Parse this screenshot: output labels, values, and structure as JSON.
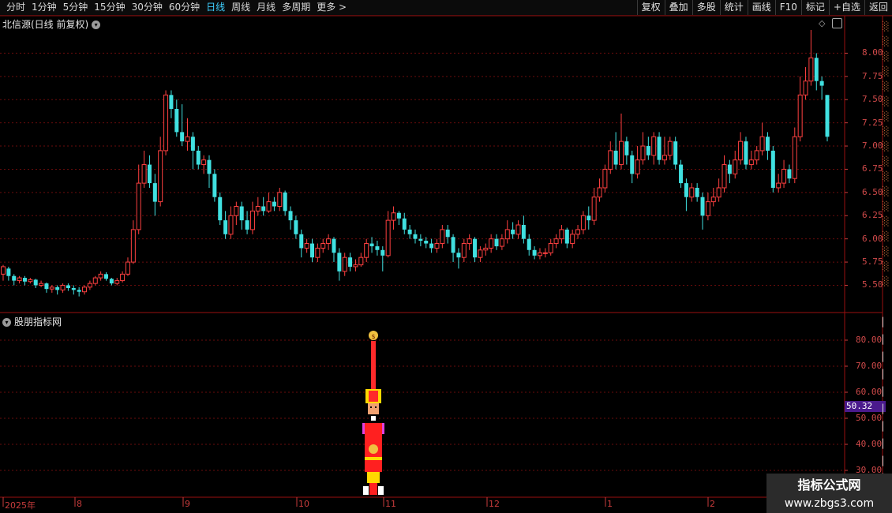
{
  "toolbar": {
    "periods": [
      "分时",
      "1分钟",
      "5分钟",
      "15分钟",
      "30分钟",
      "60分钟",
      "日线",
      "周线",
      "月线",
      "多周期",
      "更多 >"
    ],
    "active_period": "日线",
    "buttons": [
      "复权",
      "叠加",
      "多股",
      "统计",
      "画线",
      "F10",
      "标记",
      "+自选",
      "返回"
    ]
  },
  "main_pane": {
    "title": "北信源(日线 前复权)",
    "price_ticks": [
      "8.00",
      "7.75",
      "7.50",
      "7.25",
      "7.00",
      "6.75",
      "6.50",
      "6.25",
      "6.00",
      "5.75",
      "5.50"
    ]
  },
  "indicator_pane": {
    "title": "股朋指标网",
    "ticks": [
      "80.00",
      "70.00",
      "60.00",
      "50.00",
      "40.00",
      "30.00"
    ],
    "current_value": "50.32"
  },
  "dates": [
    "2025年",
    "8",
    "9",
    "10",
    "11",
    "12",
    "1",
    "2"
  ],
  "watermark": {
    "line1": "指标公式网",
    "line2": "www.zbgs3.com"
  },
  "colors": {
    "up": "#ff4040",
    "down": "#40e0e0",
    "grid": "#6a0c0c",
    "active": "#3fd0ff"
  },
  "chart_data": {
    "type": "candlestick",
    "ylim": [
      5.3,
      8.25
    ],
    "candles": [
      [
        5.62,
        5.7,
        5.72,
        5.55
      ],
      [
        5.68,
        5.6,
        5.7,
        5.55
      ],
      [
        5.6,
        5.55,
        5.62,
        5.5
      ],
      [
        5.55,
        5.58,
        5.6,
        5.52
      ],
      [
        5.58,
        5.54,
        5.6,
        5.5
      ],
      [
        5.54,
        5.56,
        5.58,
        5.52
      ],
      [
        5.56,
        5.5,
        5.57,
        5.47
      ],
      [
        5.5,
        5.52,
        5.55,
        5.48
      ],
      [
        5.52,
        5.46,
        5.53,
        5.42
      ],
      [
        5.46,
        5.48,
        5.5,
        5.42
      ],
      [
        5.48,
        5.45,
        5.5,
        5.4
      ],
      [
        5.45,
        5.5,
        5.52,
        5.42
      ],
      [
        5.5,
        5.47,
        5.52,
        5.44
      ],
      [
        5.47,
        5.45,
        5.5,
        5.4
      ],
      [
        5.45,
        5.43,
        5.48,
        5.38
      ],
      [
        5.43,
        5.48,
        5.5,
        5.4
      ],
      [
        5.48,
        5.52,
        5.55,
        5.45
      ],
      [
        5.52,
        5.58,
        5.6,
        5.5
      ],
      [
        5.58,
        5.62,
        5.65,
        5.55
      ],
      [
        5.62,
        5.57,
        5.64,
        5.55
      ],
      [
        5.57,
        5.52,
        5.58,
        5.5
      ],
      [
        5.52,
        5.55,
        5.58,
        5.5
      ],
      [
        5.55,
        5.62,
        5.65,
        5.53
      ],
      [
        5.62,
        5.75,
        5.8,
        5.6
      ],
      [
        5.75,
        6.1,
        6.2,
        5.73
      ],
      [
        6.1,
        6.6,
        6.8,
        6.05
      ],
      [
        6.6,
        6.8,
        6.95,
        6.55
      ],
      [
        6.8,
        6.6,
        6.9,
        6.55
      ],
      [
        6.6,
        6.4,
        6.7,
        6.25
      ],
      [
        6.4,
        6.95,
        7.1,
        6.35
      ],
      [
        6.95,
        7.55,
        7.6,
        6.9
      ],
      [
        7.55,
        7.4,
        7.6,
        7.3
      ],
      [
        7.4,
        7.15,
        7.5,
        7.1
      ],
      [
        7.15,
        7.05,
        7.45,
        7.0
      ],
      [
        7.05,
        7.1,
        7.3,
        6.95
      ],
      [
        7.1,
        6.95,
        7.15,
        6.75
      ],
      [
        6.95,
        6.8,
        7.0,
        6.75
      ],
      [
        6.8,
        6.85,
        6.9,
        6.7
      ],
      [
        6.85,
        6.7,
        6.9,
        6.55
      ],
      [
        6.7,
        6.45,
        6.75,
        6.4
      ],
      [
        6.45,
        6.2,
        6.5,
        6.15
      ],
      [
        6.2,
        6.05,
        6.3,
        6.0
      ],
      [
        6.05,
        6.25,
        6.35,
        6.0
      ],
      [
        6.25,
        6.35,
        6.4,
        6.15
      ],
      [
        6.35,
        6.2,
        6.4,
        6.1
      ],
      [
        6.2,
        6.1,
        6.3,
        6.05
      ],
      [
        6.1,
        6.3,
        6.4,
        6.05
      ],
      [
        6.3,
        6.35,
        6.45,
        6.25
      ],
      [
        6.35,
        6.3,
        6.45,
        6.25
      ],
      [
        6.3,
        6.4,
        6.5,
        6.28
      ],
      [
        6.4,
        6.35,
        6.45,
        6.3
      ],
      [
        6.35,
        6.5,
        6.55,
        6.3
      ],
      [
        6.5,
        6.3,
        6.52,
        6.25
      ],
      [
        6.3,
        6.2,
        6.35,
        6.1
      ],
      [
        6.2,
        6.05,
        6.25,
        6.0
      ],
      [
        6.05,
        5.9,
        6.1,
        5.8
      ],
      [
        5.9,
        5.95,
        6.0,
        5.85
      ],
      [
        5.95,
        5.8,
        6.0,
        5.75
      ],
      [
        5.8,
        5.9,
        5.95,
        5.75
      ],
      [
        5.9,
        5.95,
        6.0,
        5.85
      ],
      [
        5.95,
        6.0,
        6.05,
        5.88
      ],
      [
        6.0,
        5.85,
        6.02,
        5.75
      ],
      [
        5.85,
        5.65,
        5.9,
        5.55
      ],
      [
        5.65,
        5.8,
        5.85,
        5.6
      ],
      [
        5.8,
        5.7,
        5.85,
        5.65
      ],
      [
        5.7,
        5.72,
        5.78,
        5.65
      ],
      [
        5.72,
        5.8,
        5.85,
        5.7
      ],
      [
        5.8,
        5.95,
        6.0,
        5.75
      ],
      [
        5.95,
        5.92,
        6.02,
        5.85
      ],
      [
        5.92,
        5.88,
        5.98,
        5.82
      ],
      [
        5.88,
        5.82,
        5.92,
        5.65
      ],
      [
        5.82,
        6.2,
        6.3,
        5.8
      ],
      [
        6.2,
        6.28,
        6.35,
        6.1
      ],
      [
        6.28,
        6.22,
        6.3,
        6.15
      ],
      [
        6.22,
        6.1,
        6.28,
        6.05
      ],
      [
        6.1,
        6.05,
        6.15,
        6.0
      ],
      [
        6.05,
        6.0,
        6.1,
        5.95
      ],
      [
        6.0,
        5.98,
        6.05,
        5.92
      ],
      [
        5.98,
        5.95,
        6.02,
        5.9
      ],
      [
        5.95,
        5.9,
        6.0,
        5.85
      ],
      [
        5.9,
        5.95,
        6.0,
        5.85
      ],
      [
        5.95,
        6.1,
        6.15,
        5.9
      ],
      [
        6.1,
        6.02,
        6.15,
        5.95
      ],
      [
        6.02,
        5.85,
        6.05,
        5.75
      ],
      [
        5.85,
        5.8,
        5.9,
        5.68
      ],
      [
        5.8,
        5.95,
        6.0,
        5.75
      ],
      [
        5.95,
        6.0,
        6.05,
        5.88
      ],
      [
        6.0,
        5.8,
        6.02,
        5.75
      ],
      [
        5.8,
        5.88,
        5.92,
        5.75
      ],
      [
        5.88,
        5.9,
        5.95,
        5.82
      ],
      [
        5.9,
        6.0,
        6.05,
        5.85
      ],
      [
        6.0,
        5.92,
        6.05,
        5.88
      ],
      [
        5.92,
        6.0,
        6.05,
        5.88
      ],
      [
        6.0,
        6.1,
        6.2,
        5.95
      ],
      [
        6.1,
        6.05,
        6.18,
        6.0
      ],
      [
        6.05,
        6.15,
        6.2,
        6.0
      ],
      [
        6.15,
        6.0,
        6.25,
        5.95
      ],
      [
        6.0,
        5.88,
        6.05,
        5.82
      ],
      [
        5.88,
        5.82,
        5.92,
        5.78
      ],
      [
        5.82,
        5.85,
        5.9,
        5.78
      ],
      [
        5.85,
        5.85,
        5.9,
        5.8
      ],
      [
        5.85,
        5.95,
        6.0,
        5.82
      ],
      [
        5.95,
        6.0,
        6.05,
        5.9
      ],
      [
        6.0,
        6.1,
        6.15,
        5.95
      ],
      [
        6.1,
        5.95,
        6.12,
        5.9
      ],
      [
        5.95,
        6.05,
        6.1,
        5.9
      ],
      [
        6.05,
        6.1,
        6.15,
        6.0
      ],
      [
        6.1,
        6.25,
        6.3,
        6.05
      ],
      [
        6.25,
        6.2,
        6.35,
        6.1
      ],
      [
        6.2,
        6.45,
        6.55,
        6.15
      ],
      [
        6.45,
        6.55,
        6.65,
        6.4
      ],
      [
        6.55,
        6.75,
        6.8,
        6.5
      ],
      [
        6.75,
        6.95,
        7.05,
        6.7
      ],
      [
        6.95,
        6.8,
        7.15,
        6.75
      ],
      [
        6.8,
        7.05,
        7.35,
        6.75
      ],
      [
        7.05,
        6.9,
        7.1,
        6.8
      ],
      [
        6.9,
        6.7,
        6.95,
        6.6
      ],
      [
        6.7,
        6.85,
        7.0,
        6.65
      ],
      [
        6.85,
        7.0,
        7.15,
        6.8
      ],
      [
        7.0,
        6.9,
        7.1,
        6.85
      ],
      [
        6.9,
        7.1,
        7.15,
        6.8
      ],
      [
        7.1,
        6.85,
        7.15,
        6.8
      ],
      [
        6.85,
        6.9,
        7.1,
        6.8
      ],
      [
        6.9,
        7.05,
        7.1,
        6.85
      ],
      [
        7.05,
        6.8,
        7.1,
        6.75
      ],
      [
        6.8,
        6.6,
        6.85,
        6.55
      ],
      [
        6.6,
        6.45,
        6.65,
        6.3
      ],
      [
        6.45,
        6.55,
        6.6,
        6.4
      ],
      [
        6.55,
        6.45,
        6.6,
        6.4
      ],
      [
        6.45,
        6.25,
        6.5,
        6.1
      ],
      [
        6.25,
        6.4,
        6.5,
        6.2
      ],
      [
        6.4,
        6.45,
        6.55,
        6.35
      ],
      [
        6.45,
        6.55,
        6.65,
        6.4
      ],
      [
        6.55,
        6.8,
        6.9,
        6.5
      ],
      [
        6.8,
        6.7,
        6.85,
        6.6
      ],
      [
        6.7,
        6.85,
        6.95,
        6.65
      ],
      [
        6.85,
        7.05,
        7.15,
        6.8
      ],
      [
        7.05,
        6.8,
        7.1,
        6.75
      ],
      [
        6.8,
        6.85,
        6.95,
        6.75
      ],
      [
        6.85,
        6.95,
        7.0,
        6.8
      ],
      [
        6.95,
        7.1,
        7.25,
        6.9
      ],
      [
        7.1,
        6.95,
        7.15,
        6.85
      ],
      [
        6.95,
        6.55,
        7.0,
        6.5
      ],
      [
        6.55,
        6.6,
        6.7,
        6.5
      ],
      [
        6.6,
        6.75,
        6.85,
        6.55
      ],
      [
        6.75,
        6.65,
        6.8,
        6.6
      ],
      [
        6.65,
        7.1,
        7.2,
        6.6
      ],
      [
        7.1,
        7.55,
        7.75,
        7.05
      ],
      [
        7.55,
        7.7,
        7.85,
        7.5
      ],
      [
        7.7,
        7.95,
        8.25,
        7.65
      ],
      [
        7.95,
        7.7,
        8.0,
        7.6
      ],
      [
        7.7,
        7.65,
        7.75,
        7.5
      ],
      [
        7.55,
        7.1,
        7.55,
        7.05
      ]
    ]
  }
}
